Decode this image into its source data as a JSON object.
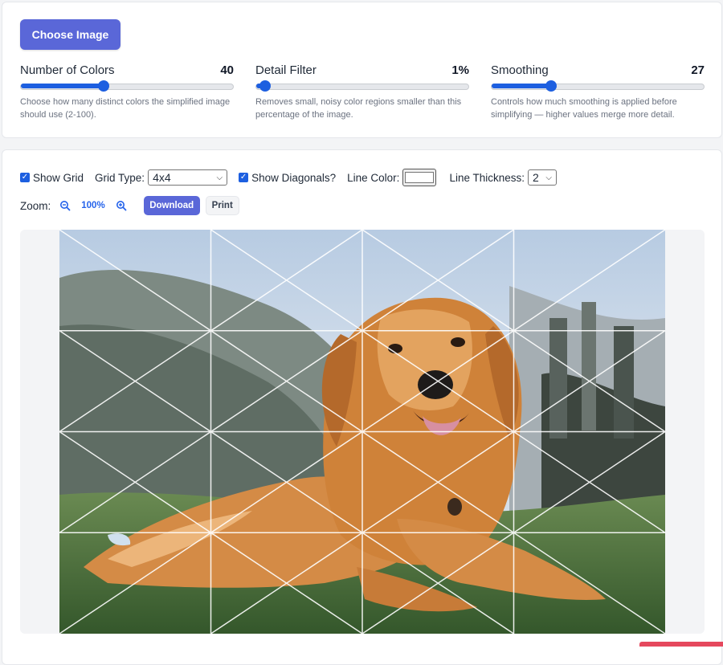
{
  "upload": {
    "choose_label": "Choose Image"
  },
  "sliders": [
    {
      "label": "Number of Colors",
      "value": "40",
      "fraction": 0.39,
      "help": "Choose how many distinct colors the simplified image should use (2-100)."
    },
    {
      "label": "Detail Filter",
      "value": "1%",
      "fraction": 0.04,
      "help": "Removes small, noisy color regions smaller than this percentage of the image."
    },
    {
      "label": "Smoothing",
      "value": "27",
      "fraction": 0.28,
      "help": "Controls how much smoothing is applied before simplifying — higher values merge more detail."
    }
  ],
  "grid": {
    "show_grid_label": "Show Grid",
    "show_grid_checked": true,
    "grid_type_label": "Grid Type:",
    "grid_type_value": "4x4",
    "show_diagonals_label": "Show Diagonals?",
    "show_diagonals_checked": true,
    "line_color_label": "Line Color:",
    "line_color": "#ffffff",
    "line_thickness_label": "Line Thickness:",
    "line_thickness_value": "2"
  },
  "zoom": {
    "label": "Zoom:",
    "value": "100%",
    "zoom_out_icon": "zoom-out-icon",
    "zoom_in_icon": "zoom-in-icon"
  },
  "actions": {
    "download_label": "Download",
    "print_label": "Print"
  },
  "colors": {
    "accent": "#5a67d8",
    "slider": "#1d5fe0",
    "link": "#2563eb"
  },
  "image": {
    "subject": "posterized golden retriever lying on grass"
  }
}
